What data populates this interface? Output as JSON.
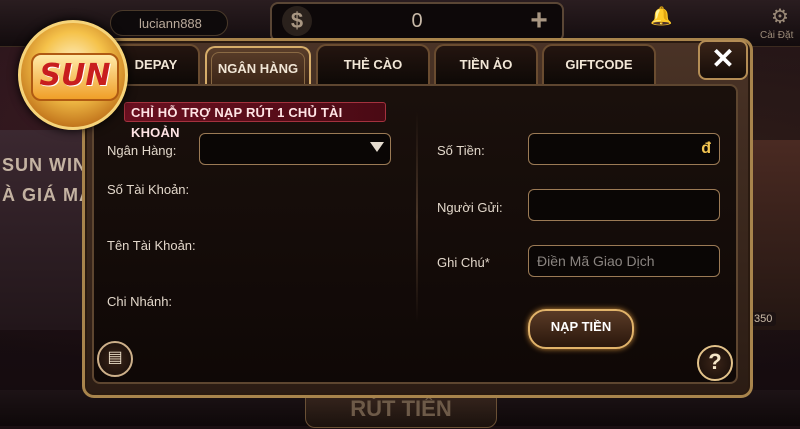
{
  "header": {
    "username": "luciann888",
    "balance": "0",
    "settings_label": "Cài Đặt"
  },
  "logo": {
    "text": "SUN"
  },
  "side": {
    "left_text": "SUN WIN\nÀ GIÁ MẠ",
    "right_number": "350"
  },
  "bottom": {
    "center_label": "RÚT TIỀN"
  },
  "dialog": {
    "tabs": [
      {
        "label": "DEPAY",
        "active": false
      },
      {
        "label": "NGÂN HÀNG",
        "active": true
      },
      {
        "label": "THẺ CÀO",
        "active": false
      },
      {
        "label": "TIỀN ẢO",
        "active": false
      },
      {
        "label": "GIFTCODE",
        "active": false
      }
    ],
    "close_label": "✕",
    "notice": "CHỈ HỖ TRỢ NẠP RÚT 1 CHỦ TÀI KHOẢN",
    "left": {
      "bank_label": "Ngân Hàng:",
      "bank_value": "",
      "account_number_label": "Số Tài Khoản:",
      "account_name_label": "Tên Tài Khoản:",
      "branch_label": "Chi Nhánh:"
    },
    "right": {
      "amount_label": "Số Tiền:",
      "amount_currency": "đ",
      "sender_label": "Người Gửi:",
      "note_label": "Ghi Chú*",
      "note_placeholder": "Điền Mã Giao Dịch",
      "submit_label": "NẠP TIỀN"
    },
    "help_label": "?"
  },
  "colors": {
    "accent_gold": "#d6ad6a",
    "notice_bg": "#6a1020",
    "currency": "#f2c451"
  }
}
